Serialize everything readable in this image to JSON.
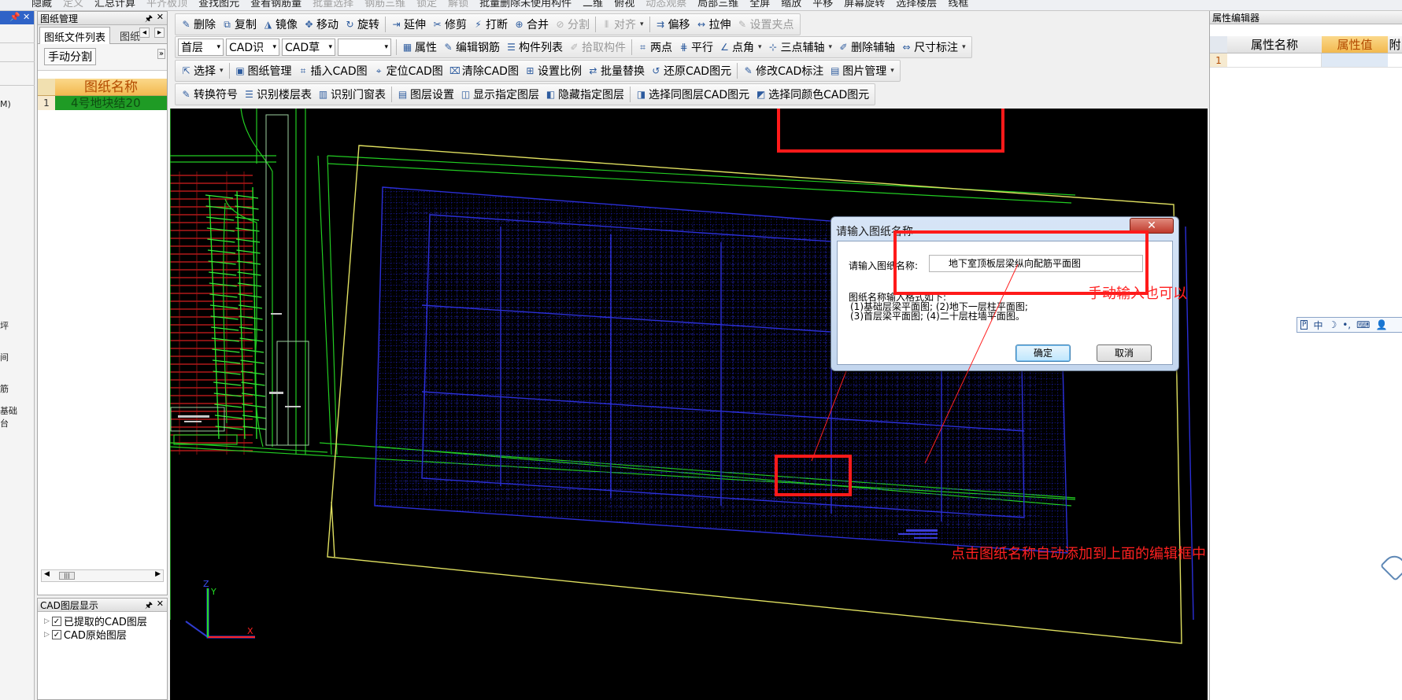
{
  "top_strip": [
    "隐藏",
    "定义",
    "汇总计算",
    "平齐板顶",
    "查找图元",
    "查看钢筋量",
    "批量选择",
    "钢筋三维",
    "锁定",
    "解锁",
    "批量删除未使用构件",
    "二维",
    "俯视",
    "动态观察",
    "局部三维",
    "全屏",
    "缩放",
    "平移",
    "屏幕旋转",
    "选择楼层",
    "线框"
  ],
  "left_panel": {
    "title": "图纸管理",
    "tab_active": "图纸文件列表",
    "tab_other": "图纸",
    "manual_split": "手动分割",
    "col_header": "图纸名称",
    "row_index": "1",
    "row_name": "4号地块结20"
  },
  "left_edge_labels": [
    "M)",
    "坪",
    "间",
    "筋",
    "基础",
    "台"
  ],
  "layer_panel": {
    "title": "CAD图层显示",
    "items": [
      "已提取的CAD图层",
      "CAD原始图层"
    ]
  },
  "toolbar1": [
    "删除",
    "复制",
    "镜像",
    "移动",
    "旋转",
    "延伸",
    "修剪",
    "打断",
    "合并",
    "分割",
    "对齐",
    "偏移",
    "拉伸",
    "设置夹点"
  ],
  "toolbar2": {
    "floor": "首层",
    "combo2": "CAD识",
    "combo3": "CAD草",
    "items": [
      "属性",
      "编辑钢筋",
      "构件列表",
      "拾取构件",
      "两点",
      "平行",
      "点角",
      "三点辅轴",
      "删除辅轴",
      "尺寸标注"
    ]
  },
  "toolbar3": [
    "选择",
    "图纸管理",
    "插入CAD图",
    "定位CAD图",
    "清除CAD图",
    "设置比例",
    "批量替换",
    "还原CAD图元",
    "修改CAD标注",
    "图片管理"
  ],
  "toolbar4": [
    "转换符号",
    "识别楼层表",
    "识别门窗表",
    "图层设置",
    "显示指定图层",
    "隐藏指定图层",
    "选择同图层CAD图元",
    "选择同颜色CAD图元"
  ],
  "props": {
    "title": "属性编辑器",
    "col_name": "属性名称",
    "col_value": "属性值",
    "col_extra": "附",
    "row_index": "1"
  },
  "dialog": {
    "title": "请输入图纸名称",
    "label": "请输入图纸名称:",
    "value": "地下室顶板层梁纵向配筋平面图",
    "hint_title": "图纸名称输入格式如下:",
    "hint_line1": "(1)基础层梁平面图;  (2)地下一层柱平面图;",
    "hint_line2": "(3)首层梁平面图;    (4)二十层柱墙平面图。",
    "ok": "确定",
    "cancel": "取消",
    "close": "✕"
  },
  "annotations": {
    "manual": "手动输入也可以",
    "auto": "点击图纸名称自动添加到上面的编辑框中"
  },
  "ime_bar": "中"
}
